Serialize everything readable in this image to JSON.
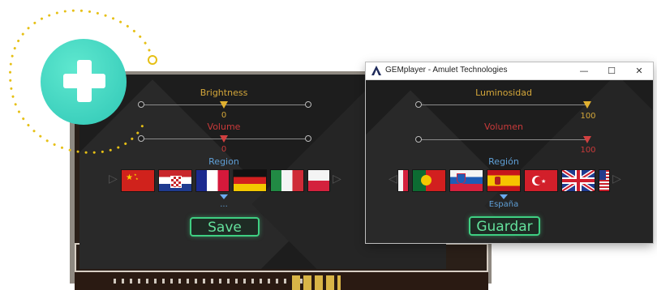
{
  "window": {
    "title": "GEMplayer - Amulet Technologies",
    "minimize_glyph": "—",
    "maximize_glyph": "☐",
    "close_glyph": "✕"
  },
  "device_screen": {
    "brightness_label": "Brightness",
    "brightness_value": "0",
    "volume_label": "Volume",
    "volume_value": "0",
    "region_label": "Region",
    "region_value": "...",
    "save_label": "Save",
    "brightness_level": 0.5,
    "volume_level": 0.5
  },
  "window_screen": {
    "brightness_label": "Luminosidad",
    "brightness_value": "100",
    "volume_label": "Volumen",
    "volume_value": "100",
    "region_label": "Región",
    "region_value": "España",
    "save_label": "Guardar",
    "brightness_level": 1.0,
    "volume_level": 1.0
  },
  "device_flags": [
    "china-flag",
    "croatia-flag",
    "france-flag",
    "germany-flag",
    "italy-flag",
    "poland-flag"
  ],
  "window_flags": [
    "portugal-flag",
    "slovenia-flag",
    "spain-flag",
    "turkey-flag",
    "uk-flag",
    "usa-flag"
  ],
  "colors": {
    "brightness": "#d4a73a",
    "volume": "#c93a3a",
    "region": "#5f9fd6",
    "button": "#3fcf82",
    "badge": "#3dd5bf",
    "dots": "#e6c015"
  },
  "icons": {
    "badge": "plus-icon",
    "app": "amulet-logo-icon"
  }
}
